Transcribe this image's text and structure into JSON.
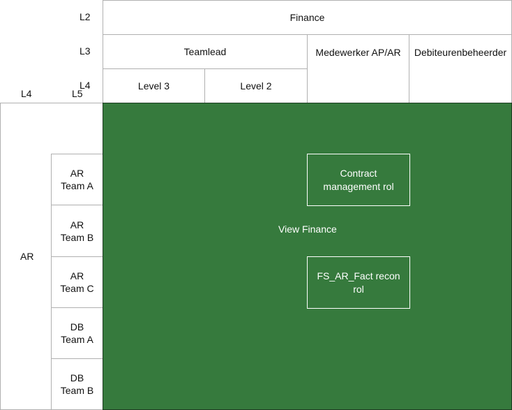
{
  "level_labels": {
    "l2": "L2",
    "l3": "L3",
    "l4_top": "L4",
    "l4_left": "L4",
    "l5_left": "L5"
  },
  "columns": {
    "l2": "Finance",
    "l3": [
      "Teamlead",
      "Medewerker AP/AR",
      "Debiteurenbeheerder"
    ],
    "l4": [
      "Level 3",
      "Level 2"
    ]
  },
  "rows": {
    "l4": "AR",
    "l5": [
      {
        "line1": "AR",
        "line2": "Team A"
      },
      {
        "line1": "AR",
        "line2": "Team B"
      },
      {
        "line1": "AR",
        "line2": "Team C"
      },
      {
        "line1": "DB",
        "line2": "Team A"
      },
      {
        "line1": "DB",
        "line2": "Team B"
      }
    ]
  },
  "matrix": {
    "fill_color": "#367a3d",
    "label": "View Finance",
    "roles": [
      {
        "line1": "Contract",
        "line2": "management rol"
      },
      {
        "line1": "FS_AR_Fact recon",
        "line2": "rol"
      }
    ]
  }
}
